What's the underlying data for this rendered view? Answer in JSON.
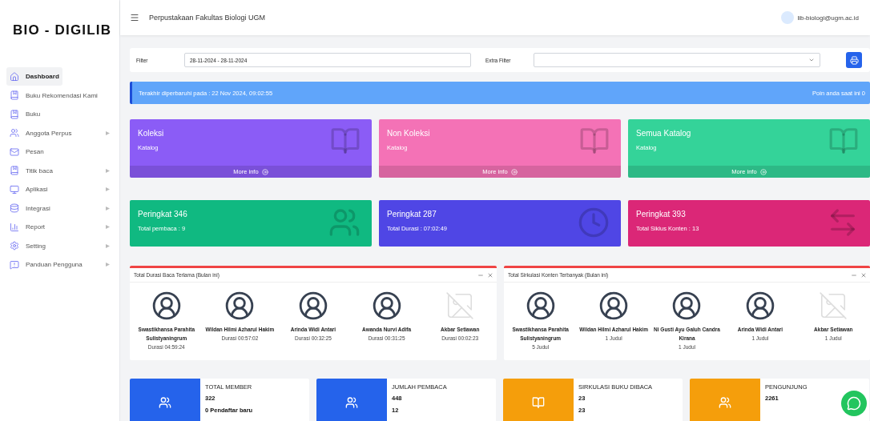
{
  "sidebar": {
    "logo": "BIO - DIGILIB",
    "items": [
      {
        "label": "Dashboard",
        "selected": true,
        "has_submenu": false
      },
      {
        "label": "Buku Rekomendasi Kami",
        "selected": false,
        "has_submenu": false
      },
      {
        "label": "Buku",
        "selected": false,
        "has_submenu": false
      },
      {
        "label": "Anggota Perpus",
        "selected": false,
        "has_submenu": true
      },
      {
        "label": "Pesan",
        "selected": false,
        "has_submenu": false
      },
      {
        "label": "Titik baca",
        "selected": false,
        "has_submenu": true
      },
      {
        "label": "Aplikasi",
        "selected": false,
        "has_submenu": true
      },
      {
        "label": "Integrasi",
        "selected": false,
        "has_submenu": true
      },
      {
        "label": "Report",
        "selected": false,
        "has_submenu": true
      },
      {
        "label": "Setting",
        "selected": false,
        "has_submenu": true
      },
      {
        "label": "Panduan Pengguna",
        "selected": false,
        "has_submenu": true
      }
    ]
  },
  "header": {
    "title": "Perpustakaan Fakultas Biologi UGM",
    "user": "lib-biologi@ugm.ac.id"
  },
  "filter": {
    "label": "Filter",
    "value": "28-11-2024 - 28-11-2024",
    "extra_label": "Extra Filter"
  },
  "banner": {
    "updated": "Terakhir diperbaruhi pada : 22 Nov 2024, 09:02:55",
    "points": "Poin anda saat ini 0"
  },
  "catalog_cards": [
    {
      "title": "Koleksi",
      "subtitle": "Katalog",
      "link": "More info",
      "color": "#8b5cf6"
    },
    {
      "title": "Non Koleksi",
      "subtitle": "Katalog",
      "link": "More info",
      "color": "#f472b6"
    },
    {
      "title": "Semua Katalog",
      "subtitle": "Katalog",
      "link": "More info",
      "color": "#34d399"
    }
  ],
  "rank_cards": [
    {
      "title": "Peringkat 346",
      "subtitle": "Total pembaca : 9",
      "color": "#10b981"
    },
    {
      "title": "Peringkat 287",
      "subtitle": "Total Durasi : 07:02:49",
      "color": "#4f46e5"
    },
    {
      "title": "Peringkat 393",
      "subtitle": "Total Siklus Konten : 13",
      "color": "#db2777"
    }
  ],
  "panels": [
    {
      "title": "Total Durasi Baca Terlama (Bulan ini)",
      "people": [
        {
          "name": "Swastikhansa Parahita Sulistyaningrum",
          "value": "Durasi 04:59:24",
          "kind": "avatar"
        },
        {
          "name": "Wildan Hilmi Azharul Hakim",
          "value": "Durasi 00:57:02",
          "kind": "avatar"
        },
        {
          "name": "Arinda Widi Antari",
          "value": "Durasi 00:32:25",
          "kind": "avatar"
        },
        {
          "name": "Awanda Nurvi Adifa",
          "value": "Durasi 00:31:25",
          "kind": "avatar"
        },
        {
          "name": "Akbar Setiawan",
          "value": "Durasi 00:02:23",
          "kind": "broken"
        }
      ]
    },
    {
      "title": "Total Sirkulasi Konten Terbanyak (Bulan ini)",
      "people": [
        {
          "name": "Swastikhansa Parahita Sulistyaningrum",
          "value": "5 Judul",
          "kind": "avatar"
        },
        {
          "name": "Wildan Hilmi Azharul Hakim",
          "value": "1 Judul",
          "kind": "avatar"
        },
        {
          "name": "Ni Gusti Ayu Galuh Candra Kirana",
          "value": "1 Judul",
          "kind": "avatar"
        },
        {
          "name": "Arinda Widi Antari",
          "value": "1 Judul",
          "kind": "avatar"
        },
        {
          "name": "Akbar Setiawan",
          "value": "1 Judul",
          "kind": "broken"
        }
      ]
    }
  ],
  "summary_cards": [
    {
      "title": "TOTAL MEMBER",
      "lines": [
        "322",
        "0 Pendaftar baru"
      ],
      "color": "#2563eb",
      "kind": "users"
    },
    {
      "title": "JUMLAH PEMBACA",
      "lines": [
        "448",
        "12"
      ],
      "color": "#2563eb",
      "kind": "users"
    },
    {
      "title": "SIRKULASI BUKU DIBACA",
      "lines": [
        "23",
        "23"
      ],
      "color": "#f59e0b",
      "kind": "book"
    },
    {
      "title": "PENGUNJUNG",
      "lines": [
        "2261"
      ],
      "color": "#f59e0b",
      "kind": "users"
    }
  ]
}
